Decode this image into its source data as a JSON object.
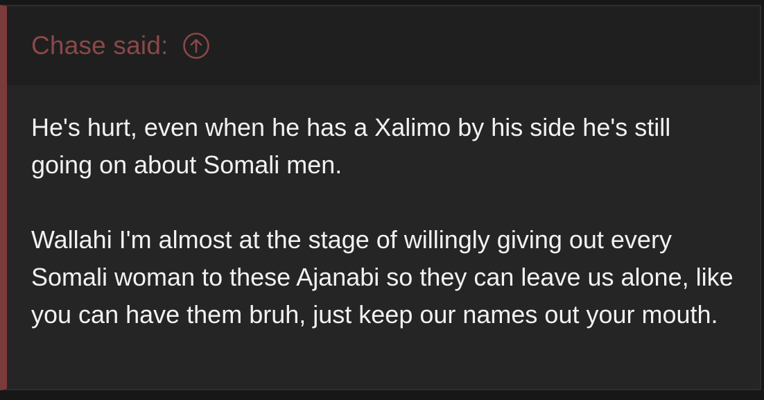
{
  "quote": {
    "author_label": "Chase said:",
    "jump_icon": "arrow-up-circle-icon",
    "accent_color": "#7b3b3b",
    "author_color": "#8b4848",
    "paragraphs": [
      "He's hurt, even when he has a Xalimo by his side he's still going on about Somali men.",
      "Wallahi I'm almost at the stage of willingly giving out every Somali woman to these Ajanabi so they can leave us alone, like you can have them bruh, just keep our names out your mouth."
    ]
  }
}
